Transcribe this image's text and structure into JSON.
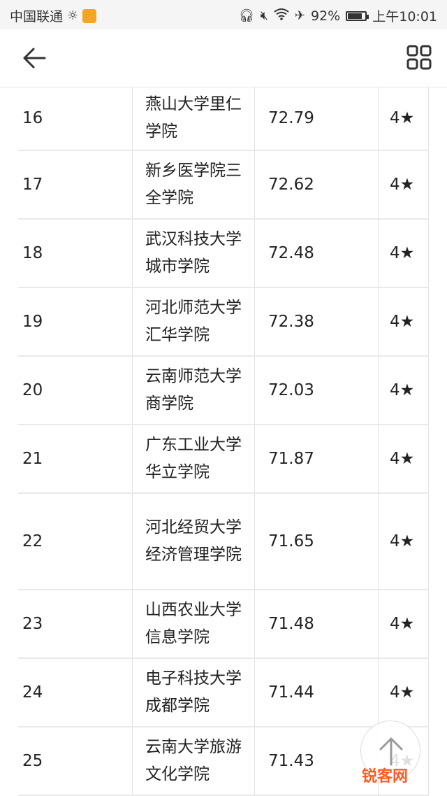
{
  "status_bar": {
    "carrier": "中国联通",
    "battery_pct": "92%",
    "battery_level": 0.92,
    "time": "上午10:01"
  },
  "rows": [
    {
      "rank": "16",
      "name": "燕山大学里仁学院",
      "score": "72.79",
      "stars": "4★"
    },
    {
      "rank": "17",
      "name": "新乡医学院三全学院",
      "score": "72.62",
      "stars": "4★"
    },
    {
      "rank": "18",
      "name": "武汉科技大学城市学院",
      "score": "72.48",
      "stars": "4★"
    },
    {
      "rank": "19",
      "name": "河北师范大学汇华学院",
      "score": "72.38",
      "stars": "4★"
    },
    {
      "rank": "20",
      "name": "云南师范大学商学院",
      "score": "72.03",
      "stars": "4★"
    },
    {
      "rank": "21",
      "name": "广东工业大学华立学院",
      "score": "71.87",
      "stars": "4★"
    },
    {
      "rank": "22",
      "name": "河北经贸大学经济管理学院",
      "score": "71.65",
      "stars": "4★"
    },
    {
      "rank": "23",
      "name": "山西农业大学信息学院",
      "score": "71.48",
      "stars": "4★"
    },
    {
      "rank": "24",
      "name": "电子科技大学成都学院",
      "score": "71.44",
      "stars": "4★"
    },
    {
      "rank": "25",
      "name": "云南大学旅游文化学院",
      "score": "71.43",
      "stars": "4★"
    }
  ],
  "watermark": "锐客网",
  "icons": {
    "back": "arrow-left-icon",
    "grid": "grid-icon",
    "scroll_top": "arrow-up-icon"
  }
}
